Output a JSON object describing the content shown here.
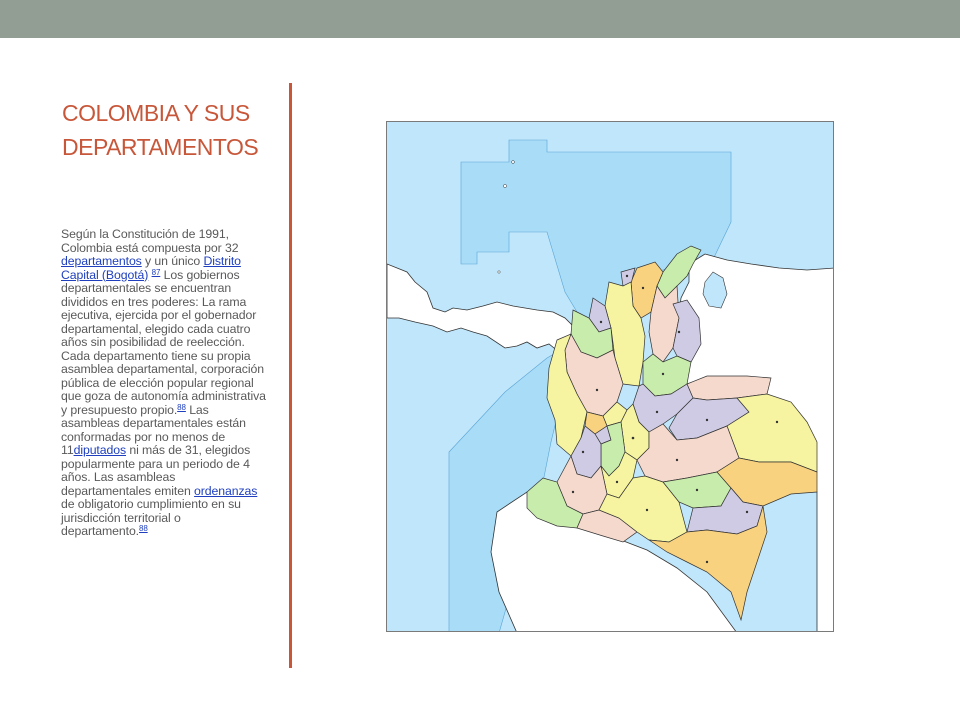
{
  "slide": {
    "title_line1": "COLOMBIA Y SUS",
    "title_line2": "DEPARTAMENTOS"
  },
  "body": {
    "t1": "Según la Constitución de 1991, Colombia está compuesta por 32 ",
    "link1": "departamentos",
    "t2": " y un único ",
    "link2": "Distrito Capital (Bogotá)",
    "ref1": "87",
    "t3": " Los gobiernos departamentales se encuentran divididos en tres poderes: La rama ejecutiva, ejercida por el gobernador departamental, elegido cada cuatro años sin posibilidad de reelección. Cada departamento tiene su propia asamblea departamental, corporación pública de elección popular regional que goza de autonomía administrativa y presupuesto propio.",
    "ref2": "88",
    "t4": " Las asambleas departamentales están conformadas por no menos de 11",
    "link3": "diputados",
    "t5": " ni más de 31, elegidos popularmente para un periodo de 4 años. Las asambleas departamentales emiten ",
    "link4": "ordenanzas",
    "t6": " de obligatorio cumplimiento en su jurisdicción territorial o departamento.",
    "ref3": "88"
  },
  "map": {
    "colors": {
      "sea": "#bfe6fa",
      "territorial_waters": "#a9dcf7",
      "foreign_land": "#ffffff",
      "border": "#333333",
      "yellow": "#f6f4a0",
      "pink": "#f5d9cc",
      "green": "#c8ecab",
      "lavender": "#cfcbe4",
      "orange": "#f9d27f"
    }
  }
}
